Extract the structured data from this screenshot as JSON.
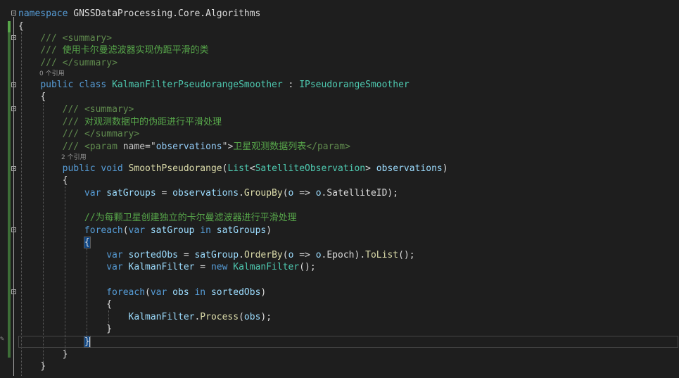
{
  "code": {
    "ln1": {
      "kw": "namespace",
      "ns": "GNSSDataProcessing.Core.Algorithms"
    },
    "ln2": {
      "brace": "{"
    },
    "ln3": {
      "slashes": "///",
      "tag": "<summary>"
    },
    "ln4": {
      "slashes": "///",
      "text": "使用卡尔曼滤波器实现伪距平滑的类"
    },
    "ln5": {
      "slashes": "///",
      "tag": "</summary>"
    },
    "lens1": "0 个引用",
    "ln6": {
      "public": "public",
      "class": "class",
      "name": "KalmanFilterPseudorangeSmoother",
      "colon": ":",
      "iface": "IPseudorangeSmoother"
    },
    "ln7": {
      "brace": "{"
    },
    "ln8": {
      "slashes": "///",
      "tag": "<summary>"
    },
    "ln9": {
      "slashes": "///",
      "text": "对观测数据中的伪距进行平滑处理"
    },
    "ln10": {
      "slashes": "///",
      "tag": "</summary>"
    },
    "ln11": {
      "slashes": "///",
      "open": "<param",
      "attr": "name",
      "eq": "=\"",
      "value": "observations",
      "close": "\">",
      "text": "卫星观测数据列表",
      "end": "</param>"
    },
    "lens2": "2 个引用",
    "ln12": {
      "public": "public",
      "void": "void",
      "method": "SmoothPseudorange",
      "paren": "(",
      "list": "List",
      "lt": "<",
      "gtype": "SatelliteObservation",
      "gt": ">",
      "param": "observations",
      "close": ")"
    },
    "ln13": {
      "brace": "{"
    },
    "ln14": {
      "var": "var",
      "name": "satGroups",
      "eq": " = ",
      "obj": "observations",
      "dot": ".",
      "method": "GroupBy",
      "args1": "(",
      "o": "o",
      "arrow": " => ",
      "o2": "o",
      "rest": ".SatelliteID);"
    },
    "ln15": {
      "comment": "//为每颗卫星创建独立的卡尔曼滤波器进行平滑处理"
    },
    "ln16": {
      "foreach": "foreach",
      "open": "(",
      "var": "var",
      "name": "satGroup",
      "in": "in",
      "coll": "satGroups",
      "close": ")"
    },
    "ln17": {
      "brace": "{"
    },
    "ln18": {
      "var": "var",
      "name": "sortedObs",
      "eq": " = ",
      "obj": "satGroup",
      "dot": ".",
      "method": "OrderBy",
      "args1": "(",
      "o": "o",
      "arrow": " => ",
      "o2": "o",
      "mid": ".Epoch).",
      "method2": "ToList",
      "end": "();"
    },
    "ln19": {
      "var": "var",
      "name": "KalmanFilter",
      "eq": " = ",
      "new": "new",
      "type": "KalmanFilter",
      "end": "();"
    },
    "ln20": {
      "foreach": "foreach",
      "open": "(",
      "var": "var",
      "name": "obs",
      "in": "in",
      "coll": "sortedObs",
      "close": ")"
    },
    "ln21": {
      "brace": "{"
    },
    "ln22": {
      "obj": "KalmanFilter",
      "dot": ".",
      "method": "Process",
      "open": "(",
      "arg": "obs",
      "end": ");"
    },
    "ln23": {
      "brace": "}"
    },
    "ln24": {
      "brace": "}"
    },
    "ln25": {
      "brace": "}"
    },
    "ln26": {
      "brace": "}"
    }
  },
  "colors": {
    "background": "#1e1e1e",
    "keyword": "#569cd6",
    "type": "#4ec9b0",
    "method": "#dcdcaa",
    "variable": "#9cdcfe",
    "comment": "#57a64a",
    "change_bar": "#57a64a"
  },
  "icons": {
    "fold": "collapse-box-icon",
    "edit": "pencil-icon"
  }
}
